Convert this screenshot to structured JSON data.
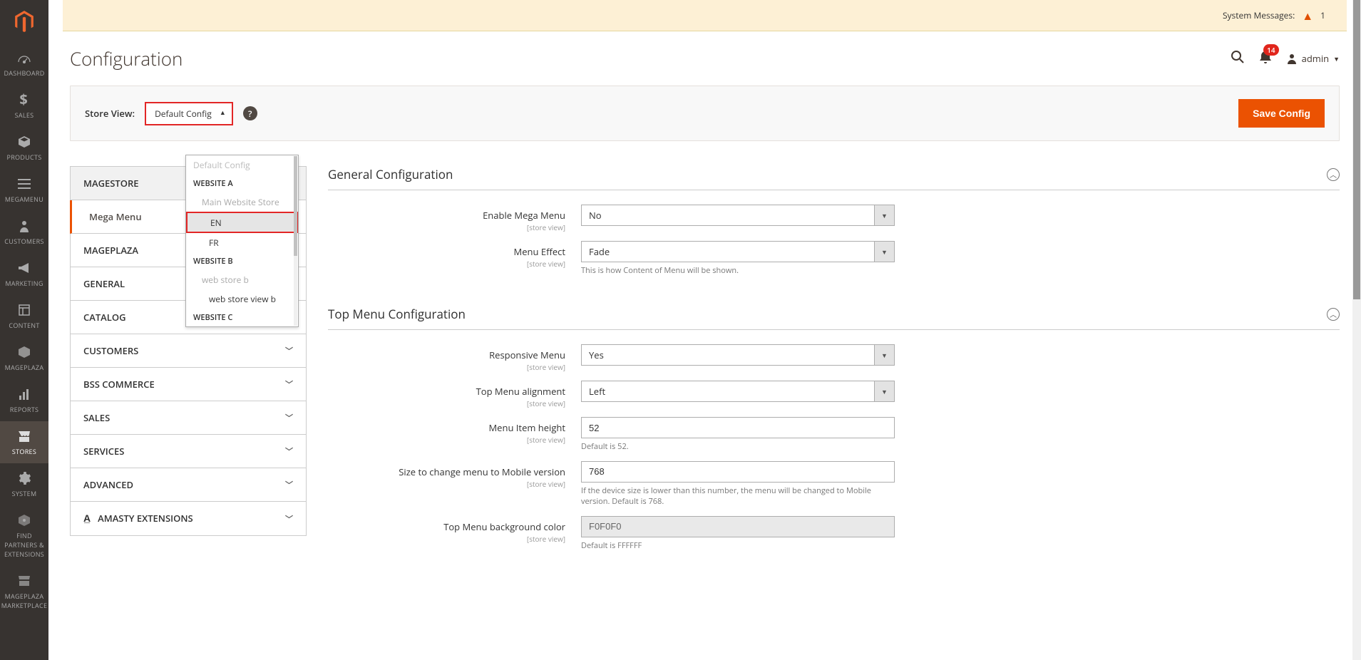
{
  "system_messages_label": "System Messages:",
  "system_messages_count": "1",
  "page_title": "Configuration",
  "notifications_count": "14",
  "user_name": "admin",
  "store_view_label": "Store View:",
  "store_view_value": "Default Config",
  "save_button": "Save Config",
  "scope": {
    "default": "Default Config",
    "website_a": "WEBSITE A",
    "main_store": "Main Website Store",
    "en": "EN",
    "fr": "FR",
    "website_b": "WEBSITE B",
    "webstore_b": "web store b",
    "webstore_view_b": "web store view b",
    "website_c": "WEBSITE C"
  },
  "sidebar": {
    "dashboard": "DASHBOARD",
    "sales": "SALES",
    "products": "PRODUCTS",
    "megamenu": "MEGAMENU",
    "customers": "CUSTOMERS",
    "marketing": "MARKETING",
    "content": "CONTENT",
    "mageplaza": "MAGEPLAZA",
    "reports": "REPORTS",
    "stores": "STORES",
    "system": "SYSTEM",
    "find_partners": "FIND PARTNERS & EXTENSIONS",
    "mageplaza_mkt": "MAGEPLAZA MARKETPLACE"
  },
  "tabs": {
    "magestore": "MAGESTORE",
    "megamenu_sub": "Mega Menu",
    "mageplaza": "MAGEPLAZA",
    "general": "GENERAL",
    "catalog": "CATALOG",
    "customers": "CUSTOMERS",
    "bss": "BSS COMMERCE",
    "sales": "SALES",
    "services": "SERVICES",
    "advanced": "ADVANCED",
    "amasty": "AMASTY EXTENSIONS"
  },
  "general_section": {
    "title": "General Configuration",
    "enable_label": "Enable Mega Menu",
    "enable_value": "No",
    "effect_label": "Menu Effect",
    "effect_value": "Fade",
    "effect_help": "This is how Content of Menu will be shown."
  },
  "top_section": {
    "title": "Top Menu Configuration",
    "responsive_label": "Responsive Menu",
    "responsive_value": "Yes",
    "align_label": "Top Menu alignment",
    "align_value": "Left",
    "height_label": "Menu Item height",
    "height_value": "52",
    "height_help": "Default is 52.",
    "mobile_label": "Size to change menu to Mobile version",
    "mobile_value": "768",
    "mobile_help": "If the device size is lower than this number, the menu will be changed to Mobile version. Default is 768.",
    "bg_label": "Top Menu background color",
    "bg_value": "F0F0F0",
    "bg_help": "Default is FFFFFF"
  },
  "sv_text": "[store view]"
}
